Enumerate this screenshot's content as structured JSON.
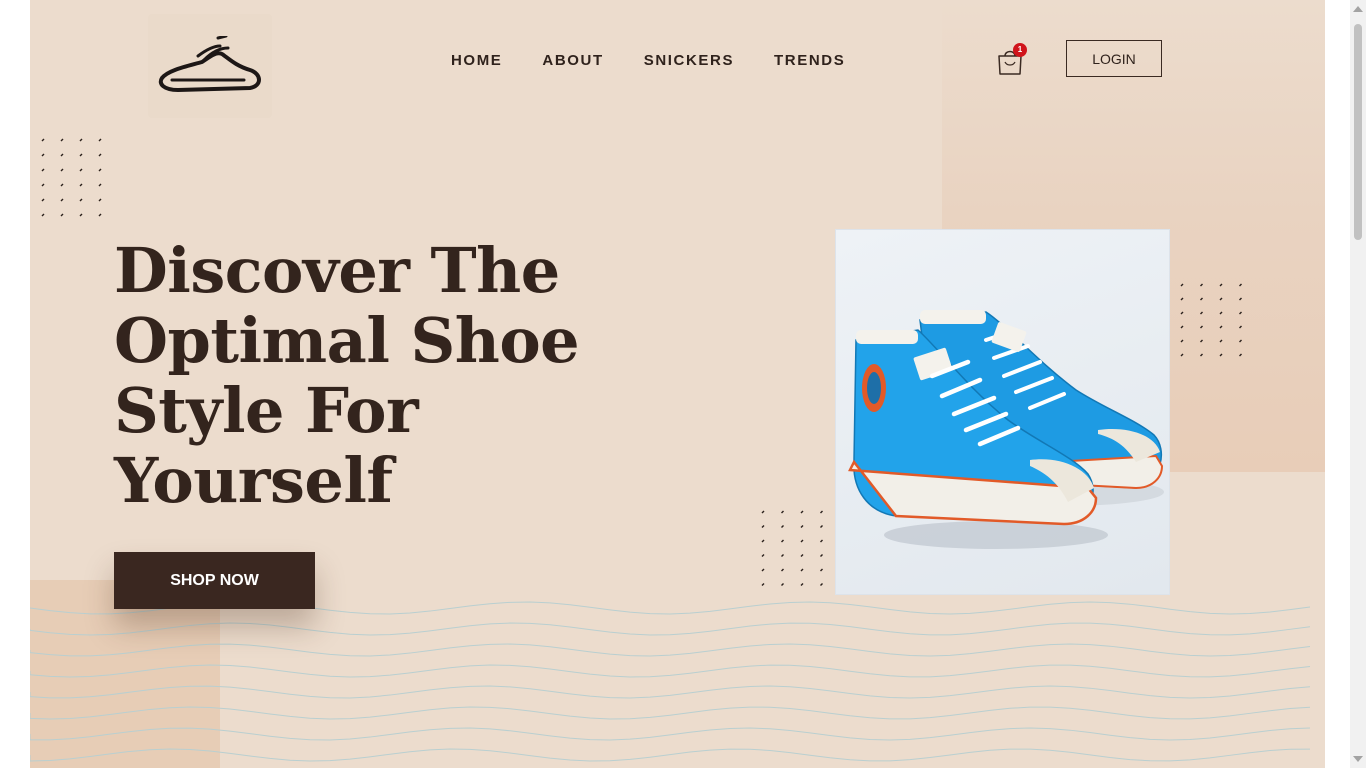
{
  "header": {
    "nav": [
      {
        "label": "HOME"
      },
      {
        "label": "ABOUT"
      },
      {
        "label": "SNICKERS"
      },
      {
        "label": "TRENDS"
      }
    ],
    "cart": {
      "icon": "shopping-bag-icon",
      "count": "1"
    },
    "login_label": "LOGIN",
    "logo_icon": "shoe-logo-icon"
  },
  "hero": {
    "title": "Discover The Optimal Shoe Style For Yourself",
    "cta_label": "SHOP NOW",
    "image_subject": "blue high-top sneakers"
  },
  "colors": {
    "background": "#ecdccd",
    "accent_dark": "#3a2720",
    "badge": "#d0141b",
    "shoe_blue": "#1e9be3"
  }
}
